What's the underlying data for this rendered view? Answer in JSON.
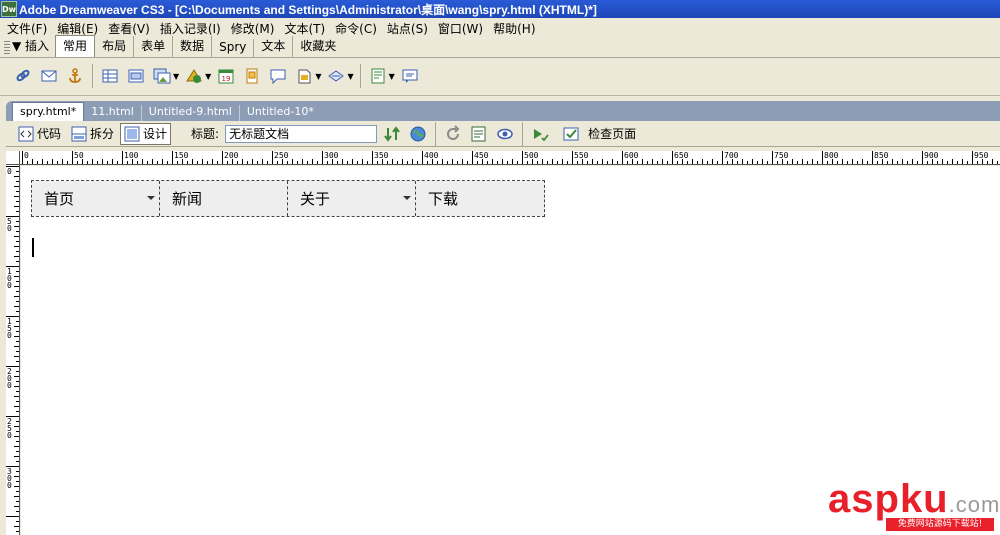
{
  "window": {
    "title": "Adobe Dreamweaver CS3 - [C:\\Documents and Settings\\Administrator\\桌面\\wang\\spry.html (XHTML)*]",
    "app_logo": "Dw"
  },
  "menubar": {
    "items": [
      "文件(F)",
      "编辑(E)",
      "查看(V)",
      "插入记录(I)",
      "修改(M)",
      "文本(T)",
      "命令(C)",
      "站点(S)",
      "窗口(W)",
      "帮助(H)"
    ]
  },
  "insert_panel": {
    "label": "▼ 插入",
    "tabs": [
      {
        "label": "常用",
        "active": true
      },
      {
        "label": "布局",
        "active": false
      },
      {
        "label": "表单",
        "active": false
      },
      {
        "label": "数据",
        "active": false
      },
      {
        "label": "Spry",
        "active": false
      },
      {
        "label": "文本",
        "active": false
      },
      {
        "label": "收藏夹",
        "active": false
      }
    ],
    "icons": [
      "hyperlink-icon",
      "email-link-icon",
      "named-anchor-icon",
      "table-icon",
      "div-icon",
      "images-icon",
      "media-icon",
      "date-icon",
      "server-include-icon",
      "comment-icon",
      "head-icon",
      "script-icon",
      "templates-icon",
      "tag-chooser-icon"
    ]
  },
  "doc_tabs": [
    {
      "label": "spry.html*",
      "active": true
    },
    {
      "label": "11.html",
      "active": false
    },
    {
      "label": "Untitled-9.html",
      "active": false
    },
    {
      "label": "Untitled-10*",
      "active": false
    }
  ],
  "doc_toolbar": {
    "code_label": "代码",
    "split_label": "拆分",
    "design_label": "设计",
    "title_label": "标题:",
    "title_value": "无标题文档",
    "check_page_label": "检查页面"
  },
  "ruler": {
    "top_ticks": [
      "0",
      "50",
      "100",
      "150",
      "200",
      "250",
      "300",
      "350",
      "400",
      "450",
      "500",
      "550",
      "600",
      "650",
      "700",
      "750",
      "800",
      "850",
      "900",
      "950"
    ],
    "left_ticks": [
      "0",
      "50",
      "100",
      "150",
      "200",
      "250",
      "300"
    ]
  },
  "canvas": {
    "menu_items": [
      {
        "label": "首页",
        "has_submenu": true
      },
      {
        "label": "新闻",
        "has_submenu": false
      },
      {
        "label": "关于",
        "has_submenu": true
      },
      {
        "label": "下载",
        "has_submenu": false
      }
    ]
  },
  "watermark": {
    "brand_red": "asp",
    "brand_gray": "ku",
    "domain": ".com",
    "slogan": "免费网站源码下载站!"
  },
  "colors": {
    "titlebar": "#1d47b8",
    "chrome": "#ece9d8",
    "doc_tabs_bg": "#8d9db6",
    "watermark_red": "#e8202a"
  }
}
